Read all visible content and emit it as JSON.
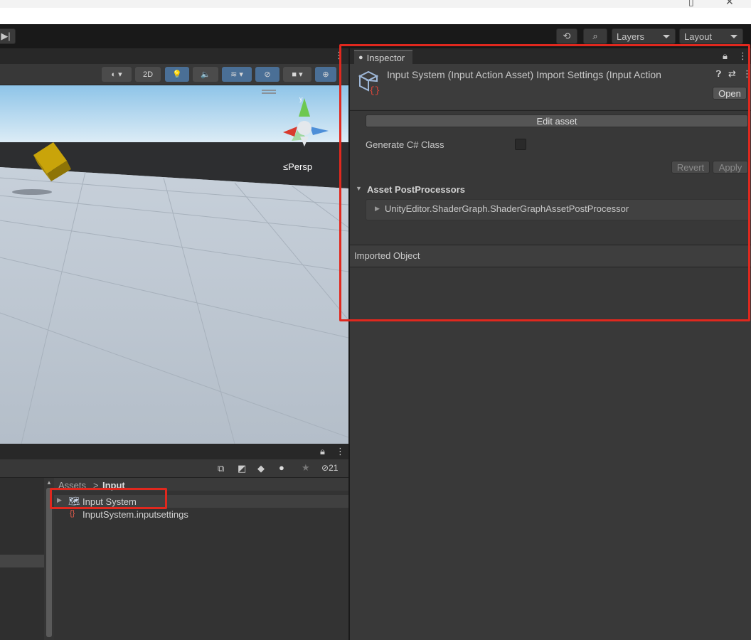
{
  "toolbar": {
    "layers_label": "Layers",
    "layout_label": "Layout"
  },
  "scene": {
    "toggle_2d_label": "2D",
    "persp_label": "Persp"
  },
  "project": {
    "hidden_count": "21",
    "breadcrumb": {
      "root": "Assets",
      "separator": ">",
      "current": "Input"
    },
    "items": [
      {
        "label": "Input System"
      },
      {
        "label": "InputSystem.inputsettings"
      }
    ]
  },
  "inspector": {
    "tab_label": "Inspector",
    "header_title": "Input System (Input Action Asset) Import Settings (Input Action",
    "open_label": "Open",
    "edit_asset_label": "Edit asset",
    "generate_class_label": "Generate C# Class",
    "revert_label": "Revert",
    "apply_label": "Apply",
    "postprocessors_label": "Asset PostProcessors",
    "postprocessor_item": "UnityEditor.ShaderGraph.ShaderGraphAssetPostProcessor",
    "imported_object_label": "Imported Object"
  },
  "colors": {
    "highlight": "#e0281e",
    "accent_blue": "#4a6f96",
    "cube": "#c9a40a"
  }
}
